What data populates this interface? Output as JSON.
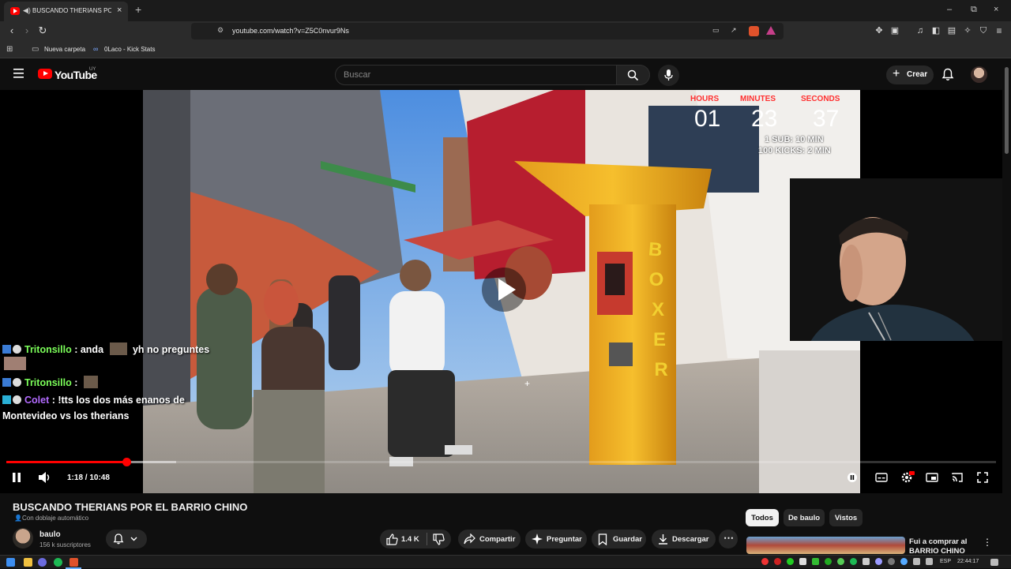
{
  "browser": {
    "tab_title": "BUSCANDO THERIANS POR EL BARRIO CHINO",
    "url": "youtube.com/watch?v=Z5C0nvur9Ns",
    "bookmarks": [
      "Nueva carpeta",
      "0Laco - Kick Stats"
    ]
  },
  "youtube": {
    "logo_text": "YouTube",
    "country": "UY",
    "search_placeholder": "Buscar",
    "create_label": "Crear"
  },
  "player": {
    "timer_labels": [
      "HOURS",
      "MINUTES",
      "SECONDS"
    ],
    "timer_values": [
      "01",
      "23",
      "37"
    ],
    "timer_rules": [
      "1 SUB: 10 MIN",
      "100 KICKS: 2 MIN"
    ],
    "time_display": "1:18 / 10:48",
    "progress_fraction": 0.121,
    "chat": [
      {
        "user": "Tritonsillo",
        "text": " : anda ",
        "text2": " yh no preguntes",
        "color": "#7cff5a"
      },
      {
        "user": "Tritonsillo",
        "text": " : ",
        "text2": "",
        "color": "#7cff5a"
      },
      {
        "user": "Colet",
        "text": " : !tts los dos más enanos de",
        "line2": "Montevideo vs los therians",
        "color": "#b36bff"
      }
    ]
  },
  "video": {
    "title": "BUSCANDO THERIANS POR EL BARRIO CHINO",
    "dub_label": "Con doblaje automático",
    "channel_name": "baulo",
    "subscribers": "156 k suscriptores",
    "likes": "1.4 K",
    "share_label": "Compartir",
    "ask_label": "Preguntar",
    "save_label": "Guardar",
    "download_label": "Descargar"
  },
  "related": {
    "chips": [
      "Todos",
      "De baulo",
      "Vistos"
    ],
    "first_title": "Fui a comprar al BARRIO CHINO"
  },
  "taskbar": {
    "lang": "ESP",
    "clock": "22:44:17"
  },
  "colors": {
    "accent": "#ff0000",
    "background": "#0f0f0f",
    "timer_label": "#ff3030"
  }
}
